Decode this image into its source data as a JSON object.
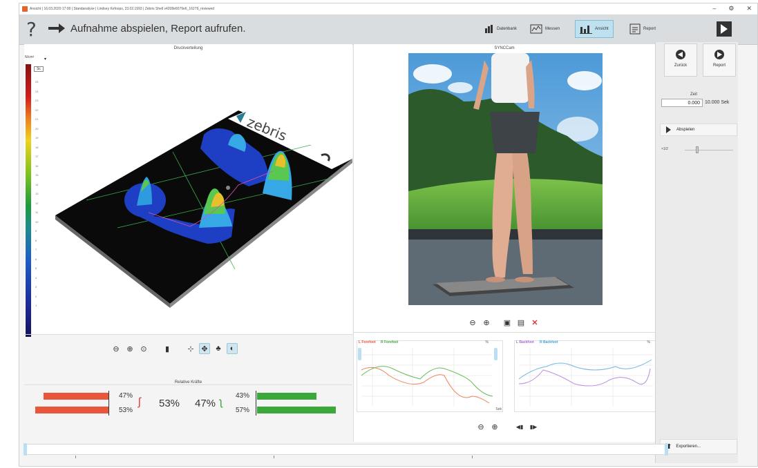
{
  "window": {
    "title": "Ansicht | 16.03.2020 17:00 | Standanalyse | Lindsey Kefoops, 23.02.1993 | Zebris Shell v4208e6079e6_16279_reviewed",
    "controls": [
      "–",
      "⚙",
      "✕"
    ]
  },
  "toolbar": {
    "help": "?",
    "headline": "Aufnahme abspielen, Report aufrufen.",
    "buttons": [
      {
        "label": "Datenbank",
        "icon": "database-icon"
      },
      {
        "label": "Messen",
        "icon": "measure-icon"
      },
      {
        "label": "Ansicht",
        "icon": "bar-chart-icon",
        "active": true
      },
      {
        "label": "Report",
        "icon": "report-icon"
      }
    ]
  },
  "pressure": {
    "title": "Druckverteilung",
    "unit": "N/cm²",
    "scale_box": "Sc",
    "tick_labels": [
      "25",
      "24",
      "23",
      "22",
      "21",
      "20",
      "19",
      "18",
      "17",
      "16",
      "15",
      "14",
      "13",
      "12",
      "11",
      "10",
      "9",
      "8",
      "7",
      "6",
      "5",
      "4",
      "3",
      "2",
      "1"
    ],
    "logo": "zebris"
  },
  "forces": {
    "title": "Relative Kräfte",
    "left_forefoot_pct": "47%",
    "left_backfoot_pct": "53%",
    "left_total": "53%",
    "right_total": "47%",
    "right_forefoot_pct": "43%",
    "right_backfoot_pct": "57%",
    "bars": {
      "left_fore": 0.47,
      "left_back": 0.53,
      "right_fore": 0.43,
      "right_back": 0.57
    },
    "color_left": "#e8573c",
    "color_right": "#3aa83a"
  },
  "camera": {
    "title": "SYNCCam"
  },
  "charts": {
    "forefoot_legend_left": "L Forefoot",
    "forefoot_legend_right": "R Forefoot",
    "backfoot_legend_left": "L Backfoot",
    "backfoot_legend_right": "R Backfoot",
    "unit": "%",
    "time_unit": "Sek"
  },
  "sidebar": {
    "back": "Zurück",
    "report": "Report",
    "time_label": "Zeit",
    "time_value": "0.000",
    "time_end": "10.000 Sek",
    "play": "Abspielen",
    "speed": "×1/2",
    "export": "Exportieren..."
  }
}
